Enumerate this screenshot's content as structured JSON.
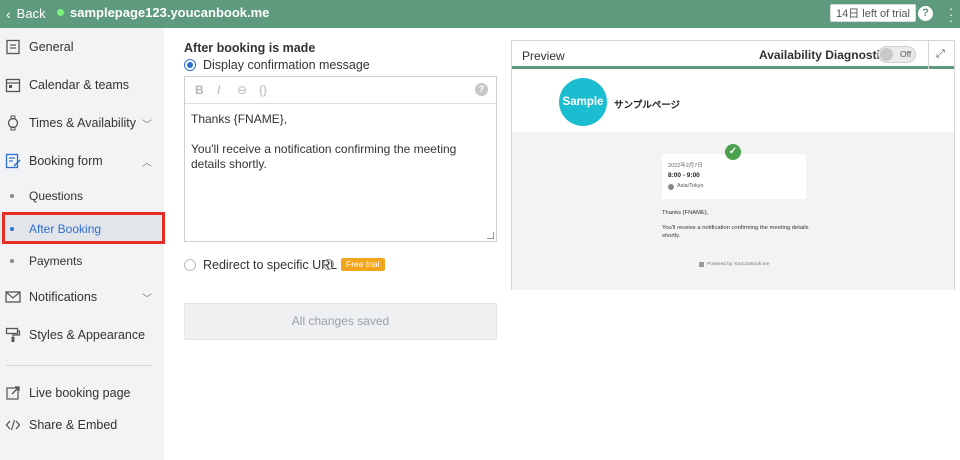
{
  "topbar": {
    "back_label": "Back",
    "url": "samplepage123.youcanbook.me",
    "trial_badge": "14日 left of trial",
    "help_glyph": "?",
    "status_color": "#7ef27a",
    "bar_color": "#5e9a7e"
  },
  "sidebar": {
    "items": [
      {
        "label": "General",
        "icon": "document-icon"
      },
      {
        "label": "Calendar & teams",
        "icon": "calendar-icon"
      },
      {
        "label": "Times & Availability",
        "icon": "watch-icon"
      },
      {
        "label": "Booking form",
        "icon": "form-edit-icon"
      },
      {
        "label": "Notifications",
        "icon": "envelope-icon"
      },
      {
        "label": "Styles & Appearance",
        "icon": "paint-roller-icon"
      },
      {
        "label": "Live booking page",
        "icon": "external-link-icon"
      },
      {
        "label": "Share & Embed",
        "icon": "code-icon"
      }
    ],
    "sub_items": [
      {
        "label": "Questions"
      },
      {
        "label": "After Booking"
      },
      {
        "label": "Payments"
      }
    ]
  },
  "main": {
    "section_title": "After booking is made",
    "option_message": "Display confirmation message",
    "option_redirect": "Redirect to specific URL",
    "free_trial_badge": "Free trial",
    "toolbar": {
      "bold": "B",
      "italic": "I",
      "link": "⊖",
      "code": "{}"
    },
    "editor_help": "?",
    "message_line1": "Thanks {FNAME},",
    "message_line2": "You'll receive a notification confirming the meeting details shortly.",
    "save_button": "All changes saved"
  },
  "preview": {
    "title": "Preview",
    "diagnostics_label": "Availability Diagnostics",
    "toggle_label": "Off",
    "logo_text": "Sample",
    "site_name": "サンプルページ",
    "date": "2022年2月7日",
    "time": "8:00 - 9:00",
    "timezone": "Asia/Tokyo",
    "thanks": "Thanks {FNAME},",
    "message": "You'll receive a notification confirming the meeting details shortly.",
    "powered_by": "Powered by YouCanBook.me"
  }
}
